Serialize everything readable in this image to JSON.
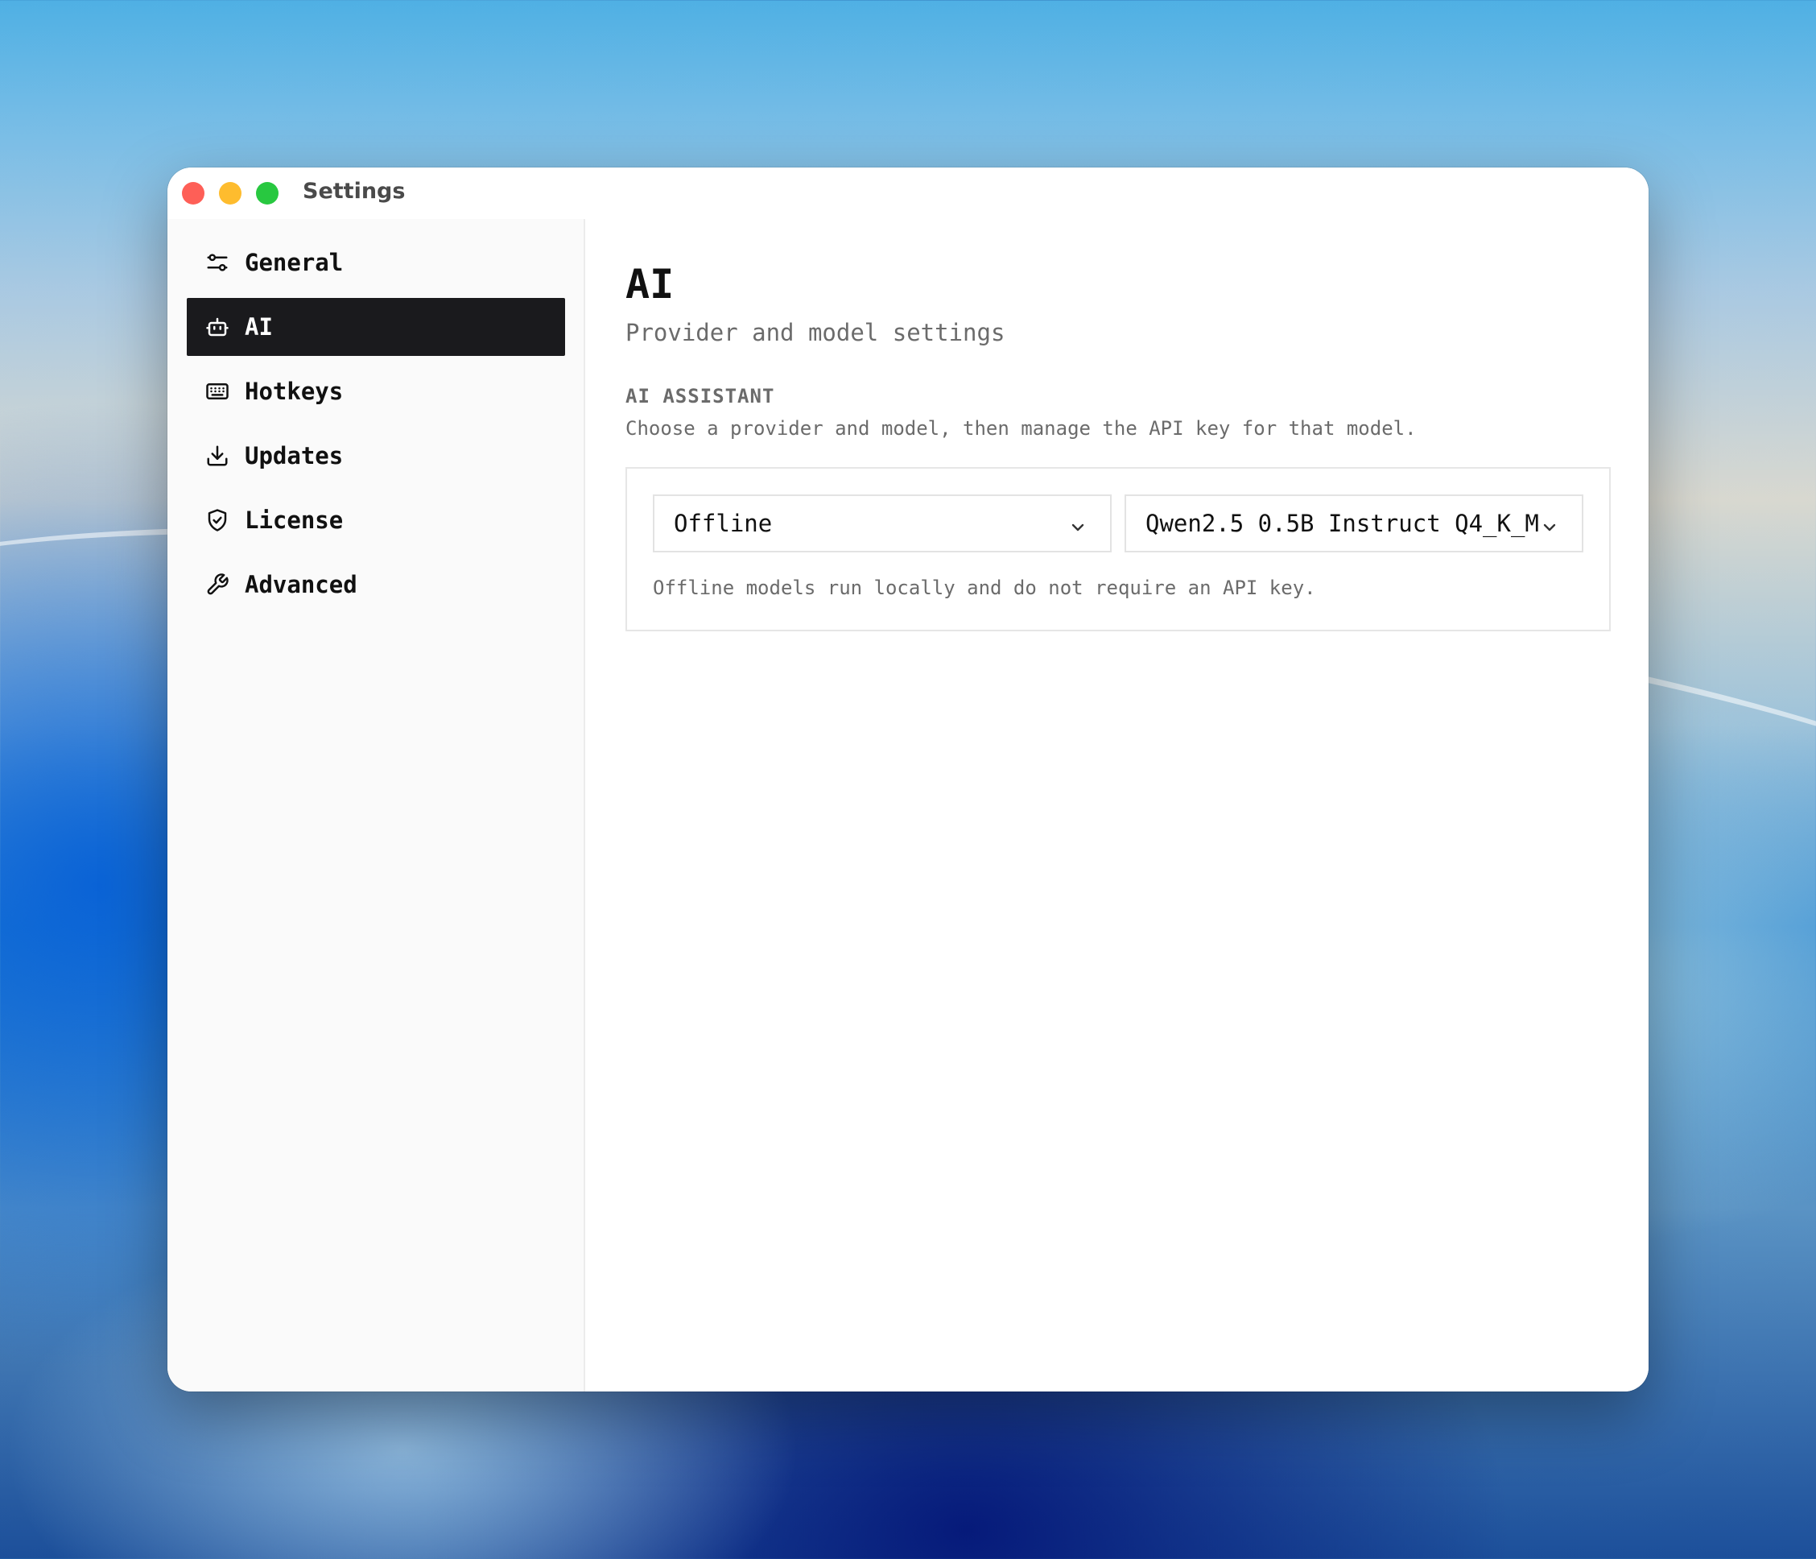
{
  "window": {
    "title": "Settings",
    "traffic_lights": {
      "close": "#fe5f57",
      "minimize": "#febc2e",
      "maximize": "#28c840"
    }
  },
  "sidebar": {
    "items": [
      {
        "label": "General",
        "icon": "sliders-icon",
        "active": false
      },
      {
        "label": "AI",
        "icon": "robot-icon",
        "active": true
      },
      {
        "label": "Hotkeys",
        "icon": "keyboard-icon",
        "active": false
      },
      {
        "label": "Updates",
        "icon": "download-icon",
        "active": false
      },
      {
        "label": "License",
        "icon": "shield-check-icon",
        "active": false
      },
      {
        "label": "Advanced",
        "icon": "wrench-icon",
        "active": false
      }
    ]
  },
  "main": {
    "title": "AI",
    "subtitle": "Provider and model settings",
    "section": {
      "label": "AI ASSISTANT",
      "description": "Choose a provider and model, then manage the API key for that model.",
      "provider_select": {
        "value": "Offline"
      },
      "model_select": {
        "value": "Qwen2.5 0.5B Instruct Q4_K_M"
      },
      "note": "Offline models run locally and do not require an API key."
    }
  }
}
